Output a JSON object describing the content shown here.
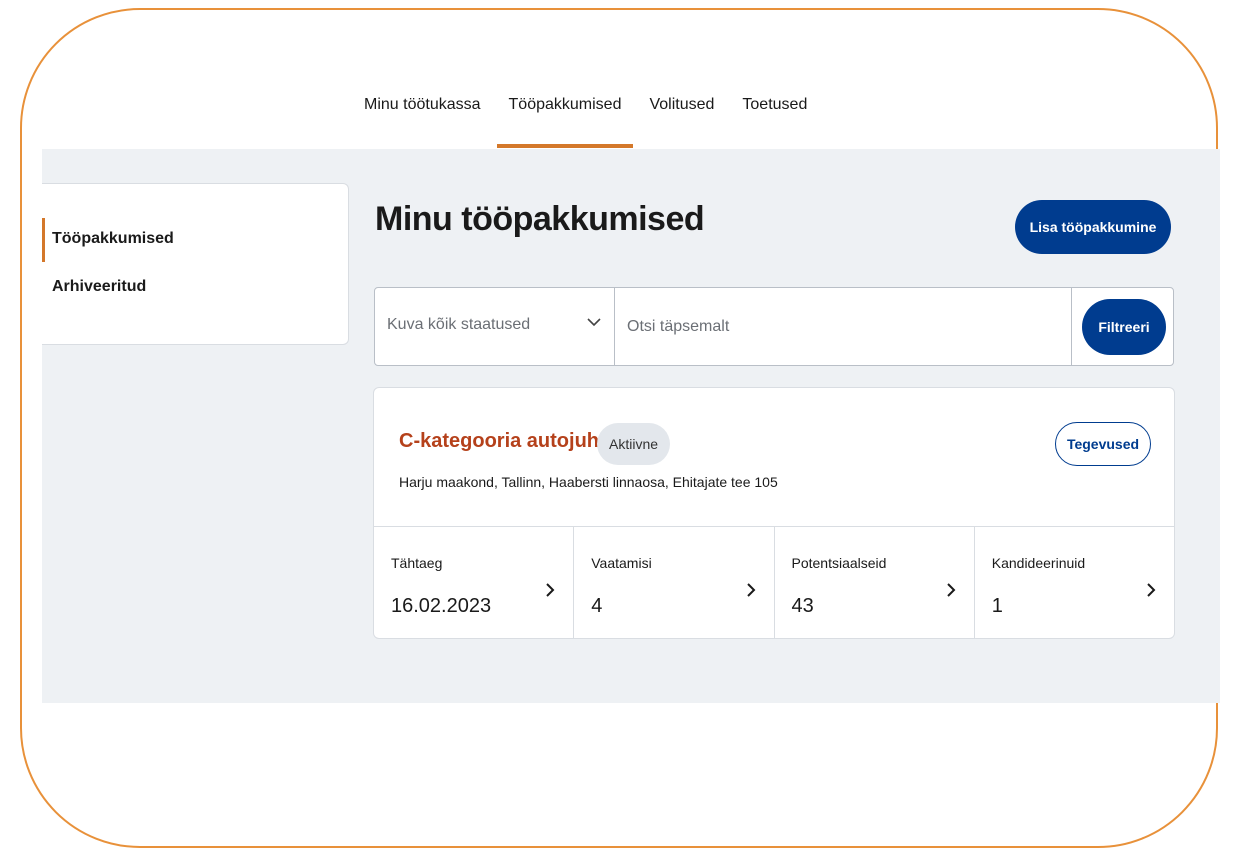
{
  "topnav": {
    "tabs": [
      {
        "label": "Minu töötukassa",
        "active": false
      },
      {
        "label": "Tööpakkumised",
        "active": true
      },
      {
        "label": "Volitused",
        "active": false
      },
      {
        "label": "Toetused",
        "active": false
      }
    ]
  },
  "sidebar": {
    "items": [
      {
        "label": "Tööpakkumised",
        "active": true
      },
      {
        "label": "Arhiveeritud",
        "active": false
      }
    ]
  },
  "main": {
    "title": "Minu tööpakkumised",
    "add_button": "Lisa tööpakkumine",
    "filter": {
      "status_value": "Kuva kõik staatused",
      "search_placeholder": "Otsi täpsemalt",
      "submit_label": "Filtreeri"
    },
    "job": {
      "title": "C-kategooria autojuht",
      "status": "Aktiivne",
      "address": "Harju maakond, Tallinn, Haabersti linnaosa, Ehitajate tee 105",
      "actions_label": "Tegevused",
      "stats": [
        {
          "label": "Tähtaeg",
          "value": "16.02.2023"
        },
        {
          "label": "Vaatamisi",
          "value": "4"
        },
        {
          "label": "Potentsiaalseid",
          "value": "43"
        },
        {
          "label": "Kandideerinuid",
          "value": "1"
        }
      ]
    }
  },
  "colors": {
    "accent_orange": "#d4782a",
    "frame_orange": "#e8913a",
    "primary_blue": "#003c8f",
    "job_title": "#b5411b",
    "content_bg": "#eef1f4"
  },
  "icons": {
    "dropdown": "chevron-down-icon",
    "stat_link": "chevron-right-icon"
  }
}
